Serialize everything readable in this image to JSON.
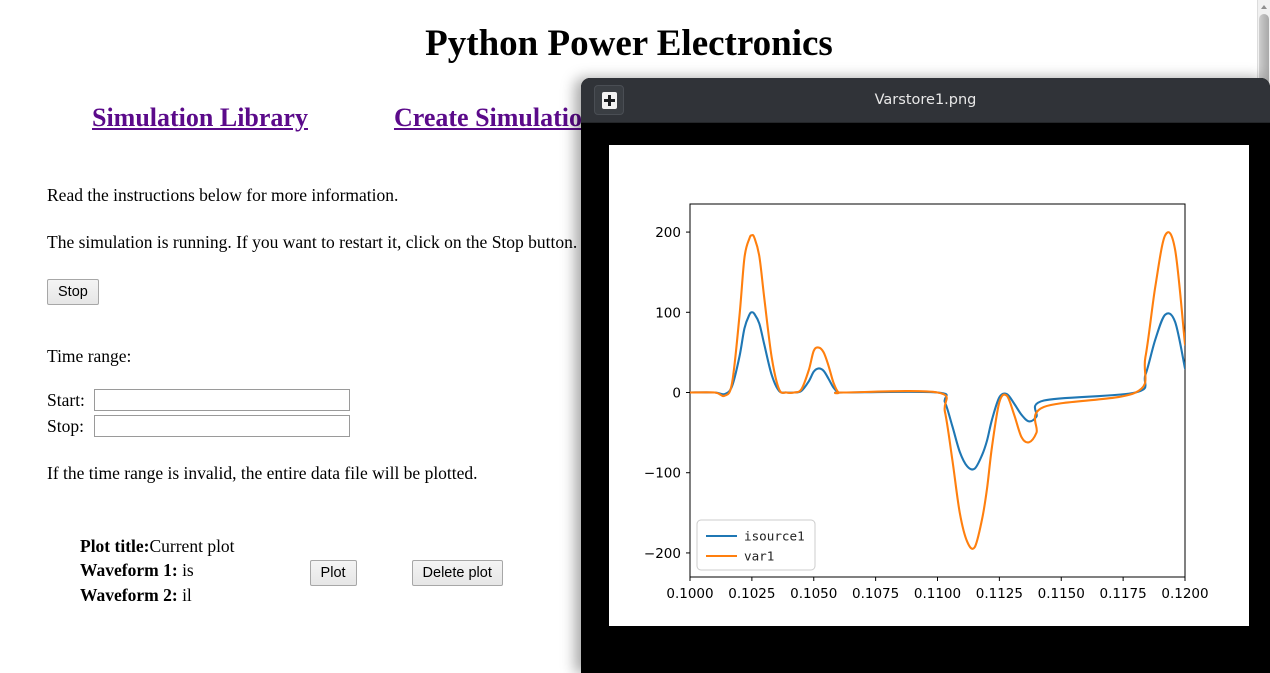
{
  "browser": {
    "page_title": "Python Power Electronics",
    "nav_links": [
      {
        "label": "Simulation Library"
      },
      {
        "label": "Create Simulation"
      }
    ],
    "instructions_line": "Read the instructions below for more information.",
    "status_line": "The simulation is running. If you want to restart it, click on the Stop button.",
    "stop_button": "Stop",
    "time_range_label": "Time range:",
    "start_label": "Start:",
    "start_value": "",
    "start_placeholder": "",
    "stop_label": "Stop:",
    "stop_value": "",
    "stop_placeholder": "",
    "invalid_range_note": "If the time range is invalid, the entire data file will be plotted.",
    "plot_title_label": "Plot title:",
    "plot_title_value": "Current plot",
    "waveform1_label": "Waveform 1:",
    "waveform1_value": "is",
    "waveform2_label": "Waveform 2:",
    "waveform2_value": "il",
    "plot_button": "Plot",
    "delete_plot_button": "Delete plot",
    "link_color": "#5b0a8a"
  },
  "viewer": {
    "window_title": "Varstore1.png",
    "menu_icon": "plus-box-icon",
    "titlebar_color": "#303338",
    "body_color": "#000000"
  },
  "chart_data": {
    "type": "line",
    "title": "",
    "xlabel": "",
    "ylabel": "",
    "xlim": [
      0.1,
      0.12
    ],
    "ylim": [
      -230,
      235
    ],
    "xticks": [
      "0.1000",
      "0.1025",
      "0.1050",
      "0.1075",
      "0.1100",
      "0.1125",
      "0.1150",
      "0.1175",
      "0.1200"
    ],
    "xtick_values": [
      0.1,
      0.1025,
      0.105,
      0.1075,
      0.11,
      0.1125,
      0.115,
      0.1175,
      0.12
    ],
    "yticks": [
      "200",
      "100",
      "0",
      "−100",
      "−200"
    ],
    "ytick_values": [
      200,
      100,
      0,
      -100,
      -200
    ],
    "grid": false,
    "legend_position": "lower left",
    "series": [
      {
        "name": "isource1",
        "color": "#1f77b4",
        "x": [
          0.1,
          0.101,
          0.1014,
          0.1017,
          0.102,
          0.1022,
          0.1024,
          0.1025,
          0.1026,
          0.1028,
          0.103,
          0.1033,
          0.1036,
          0.1039,
          0.1042,
          0.1045,
          0.1048,
          0.105,
          0.1052,
          0.1054,
          0.1056,
          0.1058,
          0.106,
          0.1062,
          0.11,
          0.1103,
          0.1106,
          0.1109,
          0.1112,
          0.1115,
          0.1118,
          0.112,
          0.1122,
          0.1125,
          0.1128,
          0.1131,
          0.1134,
          0.1137,
          0.114,
          0.1143,
          0.118,
          0.1184,
          0.1188,
          0.1192,
          0.1196,
          0.12
        ],
        "y": [
          0,
          0,
          -2,
          8,
          45,
          80,
          97,
          100,
          98,
          86,
          60,
          22,
          2,
          0,
          0,
          2,
          14,
          26,
          30,
          27,
          17,
          6,
          0,
          0,
          0,
          -12,
          -42,
          -74,
          -92,
          -95,
          -78,
          -60,
          -34,
          -6,
          -2,
          -14,
          -28,
          -36,
          -30,
          -10,
          0,
          22,
          66,
          97,
          88,
          30
        ]
      },
      {
        "name": "var1",
        "color": "#ff7f0e",
        "x": [
          0.1,
          0.101,
          0.1014,
          0.1017,
          0.102,
          0.1022,
          0.1024,
          0.1025,
          0.1026,
          0.1028,
          0.103,
          0.1033,
          0.1036,
          0.1039,
          0.1042,
          0.1045,
          0.1048,
          0.105,
          0.1052,
          0.1054,
          0.1056,
          0.1058,
          0.106,
          0.1062,
          0.11,
          0.1103,
          0.1106,
          0.1109,
          0.1112,
          0.1115,
          0.1118,
          0.112,
          0.1122,
          0.1125,
          0.1128,
          0.1131,
          0.1134,
          0.1137,
          0.114,
          0.1143,
          0.118,
          0.1184,
          0.1188,
          0.1192,
          0.1196,
          0.12
        ],
        "y": [
          0,
          0,
          -4,
          12,
          96,
          168,
          192,
          196,
          193,
          170,
          118,
          44,
          4,
          0,
          0,
          4,
          28,
          52,
          56,
          50,
          33,
          12,
          0,
          0,
          0,
          -24,
          -84,
          -150,
          -186,
          -193,
          -158,
          -120,
          -68,
          -12,
          -4,
          -28,
          -56,
          -62,
          -50,
          -18,
          0,
          44,
          132,
          196,
          178,
          60
        ]
      }
    ]
  }
}
